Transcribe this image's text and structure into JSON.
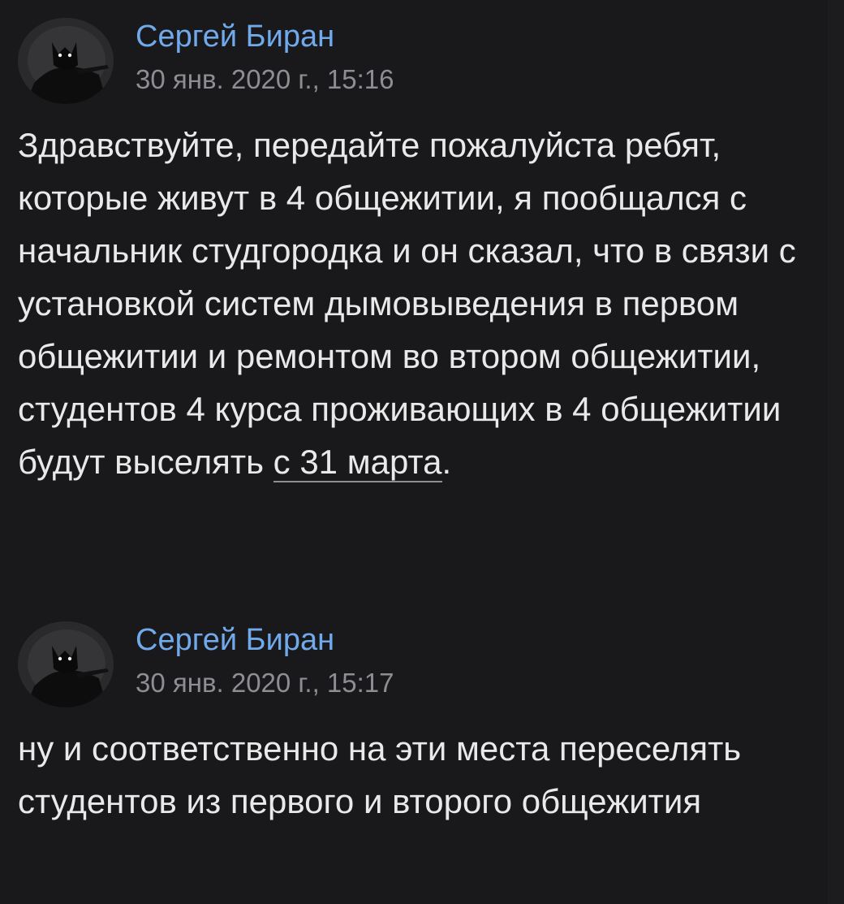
{
  "messages": [
    {
      "author": "Сергей Биран",
      "timestamp": "30 янв. 2020 г., 15:16",
      "text_before_link": "Здравствуйте, передайте пожалуйста ребят, которые живут в 4 общежитии, я пообщался с начальник студгородка и он сказал, что в связи с установкой систем дымовыведения в первом общежитии и ремонтом во втором общежитии, студентов 4 курса проживающих в 4 общежитии будут выселять ",
      "link_text": "с 31 марта",
      "text_after_link": "."
    },
    {
      "author": "Сергей Биран",
      "timestamp": "30 янв. 2020 г., 15:17",
      "text": "ну и соответственно на эти места переселять студентов из первого и второго общежития"
    }
  ],
  "icons": {
    "avatar": "avatar-image-icon"
  },
  "colors": {
    "background": "#19191b",
    "author_link": "#71aaeb",
    "text": "#e9e9ea",
    "timestamp": "#8d8d93"
  }
}
